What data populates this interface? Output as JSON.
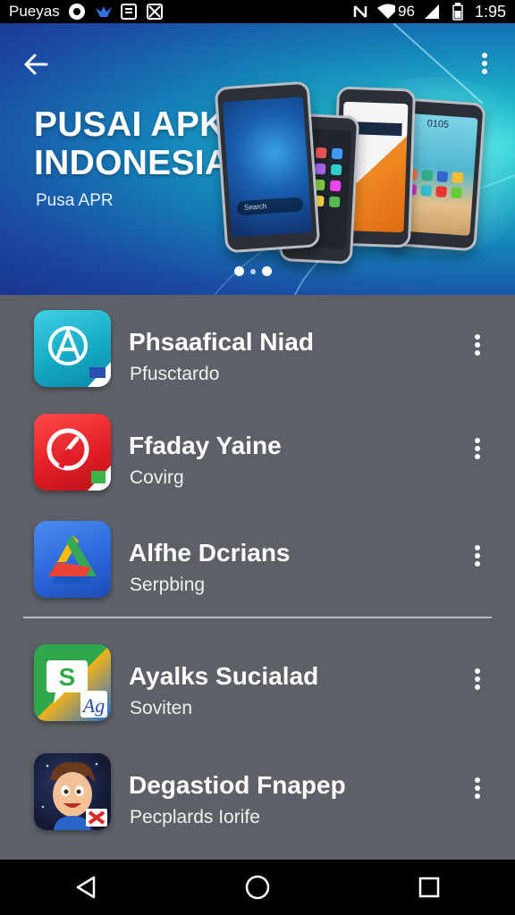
{
  "status_bar": {
    "carrier": "Pueyas",
    "battery": "96",
    "time": "1:95",
    "icons": [
      "record-icon",
      "bird-icon",
      "box-icon",
      "image-icon",
      "nfc-icon",
      "wifi-icon",
      "signal-icon",
      "battery-icon"
    ]
  },
  "banner": {
    "title_line1": "PUSAI APK",
    "title_line2": "INDONESIA",
    "subtitle": "Pusa APR",
    "phone_search_hint": "Search",
    "phone_time": "0105",
    "carousel_pages": 3,
    "carousel_active_index": 0
  },
  "apps": [
    {
      "title": "Phsaafical Niad",
      "subtitle": "Pfusctardo",
      "icon": "compass-a-app-icon"
    },
    {
      "title": "Ffaday Yaine",
      "subtitle": "Covirg",
      "icon": "red-timer-app-icon"
    },
    {
      "title": "Alfhe Dcrians",
      "subtitle": "Serpbing",
      "icon": "drive-triangle-app-icon"
    },
    {
      "title": "Ayalks Sucialad",
      "subtitle": "Soviten",
      "icon": "chat-s-app-icon"
    },
    {
      "title": "Degastiod Fnapep",
      "subtitle": "Pecplards Iorife",
      "icon": "cartoon-avatar-app-icon"
    }
  ],
  "colors": {
    "banner_dark": "#1a3590",
    "banner_light": "#38d8dc",
    "list_bg": "#5d6066",
    "bars": "#000000"
  }
}
